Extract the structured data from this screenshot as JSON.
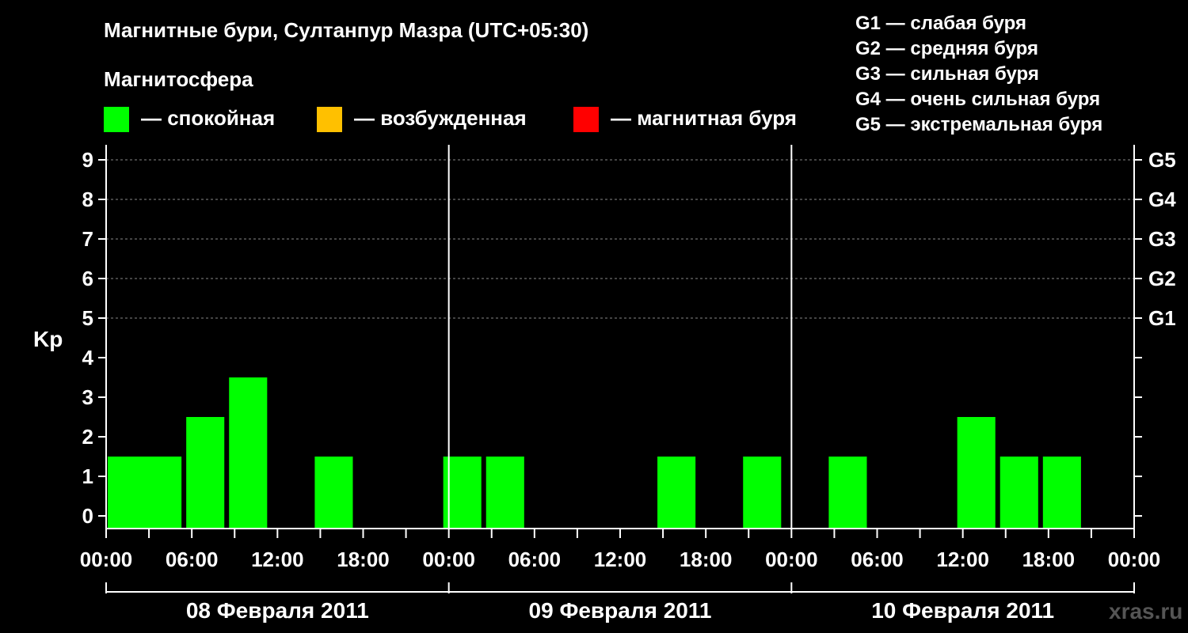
{
  "title": "Магнитные бури, Султанпур Мазра (UTC+05:30)",
  "section_label": "Магнитосфера",
  "status_legend": [
    {
      "label": "— спокойная",
      "color": "#00ff00"
    },
    {
      "label": "— возбужденная",
      "color": "#ffc000"
    },
    {
      "label": "— магнитная буря",
      "color": "#ff0000"
    }
  ],
  "g_legend": [
    "G1 — слабая буря",
    "G2 — средняя буря",
    "G3 — сильная буря",
    "G4 — очень сильная буря",
    "G5 — экстремальная буря"
  ],
  "watermark": "xras.ru",
  "chart_data": {
    "type": "bar",
    "ylabel": "Kp",
    "ylim": [
      0,
      9
    ],
    "yticks": [
      0,
      1,
      2,
      3,
      4,
      5,
      6,
      7,
      8,
      9
    ],
    "right_axis_labels": [
      {
        "kp": 5,
        "label": "G1"
      },
      {
        "kp": 6,
        "label": "G2"
      },
      {
        "kp": 7,
        "label": "G3"
      },
      {
        "kp": 8,
        "label": "G4"
      },
      {
        "kp": 9,
        "label": "G5"
      }
    ],
    "x_range_hours": [
      0,
      72
    ],
    "x_tick_labels": [
      "00:00",
      "06:00",
      "12:00",
      "18:00",
      "00:00",
      "06:00",
      "12:00",
      "18:00",
      "00:00",
      "06:00",
      "12:00",
      "18:00",
      "00:00"
    ],
    "x_tick_hours": [
      0,
      6,
      12,
      18,
      24,
      30,
      36,
      42,
      48,
      54,
      60,
      66,
      72
    ],
    "days": [
      "08 Февраля 2011",
      "09 Февраля 2011",
      "10 Февраля 2011"
    ],
    "bar_duration_hours": 3,
    "bars": [
      {
        "start": 0,
        "kp": 1,
        "status": "спокойная"
      },
      {
        "start": 2.5,
        "kp": 1,
        "status": "спокойная"
      },
      {
        "start": 5.5,
        "kp": 2,
        "status": "спокойная"
      },
      {
        "start": 8.5,
        "kp": 3,
        "status": "спокойная"
      },
      {
        "start": 14.5,
        "kp": 1,
        "status": "спокойная"
      },
      {
        "start": 23.5,
        "kp": 1,
        "status": "спокойная"
      },
      {
        "start": 26.5,
        "kp": 1,
        "status": "спокойная"
      },
      {
        "start": 38.5,
        "kp": 1,
        "status": "спокойная"
      },
      {
        "start": 44.5,
        "kp": 1,
        "status": "спокойная"
      },
      {
        "start": 50.5,
        "kp": 1,
        "status": "спокойная"
      },
      {
        "start": 59.5,
        "kp": 2,
        "status": "спокойная"
      },
      {
        "start": 62.5,
        "kp": 1,
        "status": "спокойная"
      },
      {
        "start": 65.5,
        "kp": 1,
        "status": "спокойная"
      }
    ]
  }
}
